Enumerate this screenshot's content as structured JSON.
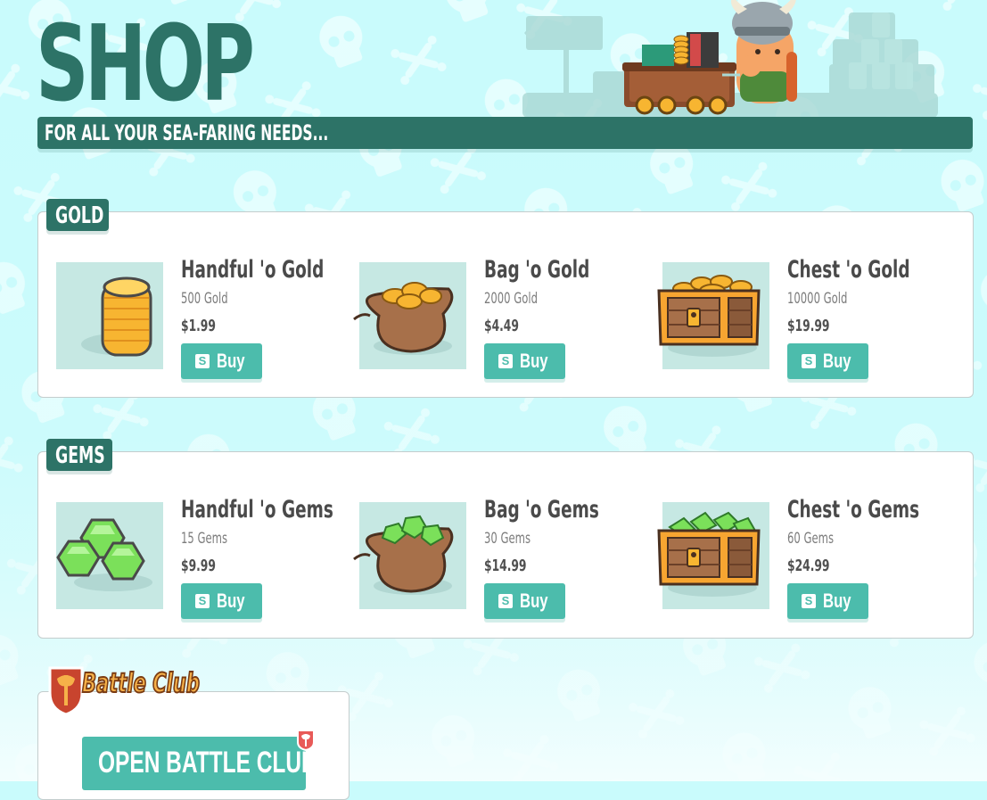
{
  "header": {
    "title": "SHOP",
    "tagline": "FOR ALL YOUR SEA-FARING NEEDS..."
  },
  "sections": [
    {
      "label": "GOLD",
      "items": [
        {
          "name": "Handful 'o Gold",
          "amount": "500 Gold",
          "price": "$1.99",
          "button": "Buy",
          "button_icon": "S",
          "icon": "gold-coin-stack-icon"
        },
        {
          "name": "Bag 'o Gold",
          "amount": "2000 Gold",
          "price": "$4.49",
          "button": "Buy",
          "button_icon": "S",
          "icon": "gold-bag-icon"
        },
        {
          "name": "Chest 'o Gold",
          "amount": "10000 Gold",
          "price": "$19.99",
          "button": "Buy",
          "button_icon": "S",
          "icon": "gold-chest-icon"
        }
      ]
    },
    {
      "label": "GEMS",
      "items": [
        {
          "name": "Handful 'o Gems",
          "amount": "15 Gems",
          "price": "$9.99",
          "button": "Buy",
          "button_icon": "S",
          "icon": "gem-cluster-icon"
        },
        {
          "name": "Bag 'o Gems",
          "amount": "30 Gems",
          "price": "$14.99",
          "button": "Buy",
          "button_icon": "S",
          "icon": "gem-bag-icon"
        },
        {
          "name": "Chest 'o Gems",
          "amount": "60 Gems",
          "price": "$24.99",
          "button": "Buy",
          "button_icon": "S",
          "icon": "gem-chest-icon"
        }
      ]
    }
  ],
  "battle_club": {
    "logo_text": "Battle Club",
    "button": "OPEN BATTLE CLUB",
    "icon": "battle-axe-shield-icon"
  },
  "colors": {
    "background": "#c9fbfc",
    "primary_dark": "#2d7367",
    "accent": "#4cbcac",
    "thumb_bg": "#c6e8e3",
    "gold": "#f7b531",
    "gem": "#7be05a"
  }
}
